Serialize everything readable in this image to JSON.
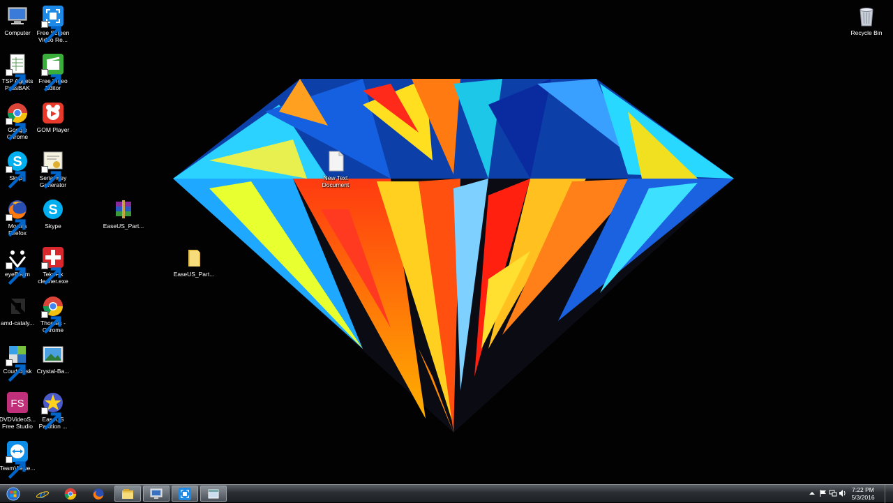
{
  "desktop": {
    "icons": [
      {
        "name": "computer",
        "label": "Computer"
      },
      {
        "name": "free-screen-video-recorder",
        "label": "Free Screen\nVideo Re..."
      },
      {
        "name": "tsp-agnets-passbak",
        "label": "TSP Agnets\nPassBAK"
      },
      {
        "name": "free-video-editor",
        "label": "Free Video\nEditor"
      },
      {
        "name": "google-chrome",
        "label": "Google\nChrome"
      },
      {
        "name": "gom-player",
        "label": "GOM Player"
      },
      {
        "name": "skype-1",
        "label": "Skype"
      },
      {
        "name": "serial-key-generator",
        "label": "Serial Key\nGenerator"
      },
      {
        "name": "mozilla-firefox",
        "label": "Mozilla\nFirefox"
      },
      {
        "name": "skype-2",
        "label": "Skype"
      },
      {
        "name": "easeus-rar",
        "label": "EaseUS_Part..."
      },
      {
        "name": "eyebeam",
        "label": "eyeBeam"
      },
      {
        "name": "teknfix-cleaner",
        "label": "TeknFix\ncleaner.exe"
      },
      {
        "name": "easeus-folder",
        "label": "EaseUS_Part..."
      },
      {
        "name": "amd-catalyst",
        "label": "amd-cataly..."
      },
      {
        "name": "thomas-chrome",
        "label": "Thomas -\nChrome"
      },
      {
        "name": "coud-desk",
        "label": "Coud-desk"
      },
      {
        "name": "crystal-ba",
        "label": "Crystal-Ba..."
      },
      {
        "name": "dvdvideosoft-free-studio",
        "label": "DVDVideoS...\nFree Studio"
      },
      {
        "name": "easeus-partition",
        "label": "EaseUS\nPartition ..."
      },
      {
        "name": "teamviewer",
        "label": "TeamViewe..."
      },
      {
        "name": "new-text-document",
        "label": "New Text\nDocument"
      },
      {
        "name": "recycle-bin",
        "label": "Recycle Bin"
      }
    ]
  },
  "taskbar": {
    "pinned": [
      "start",
      "internet-explorer",
      "google-chrome",
      "mozilla-firefox",
      "windows-explorer",
      "remote-desktop",
      "free-screen-video-recorder",
      "window-preview"
    ],
    "clock": {
      "time": "7:22 PM",
      "date": "5/3/2016"
    }
  },
  "colors": {
    "taskbar": "#2a2e33",
    "desktop": "#020202"
  }
}
